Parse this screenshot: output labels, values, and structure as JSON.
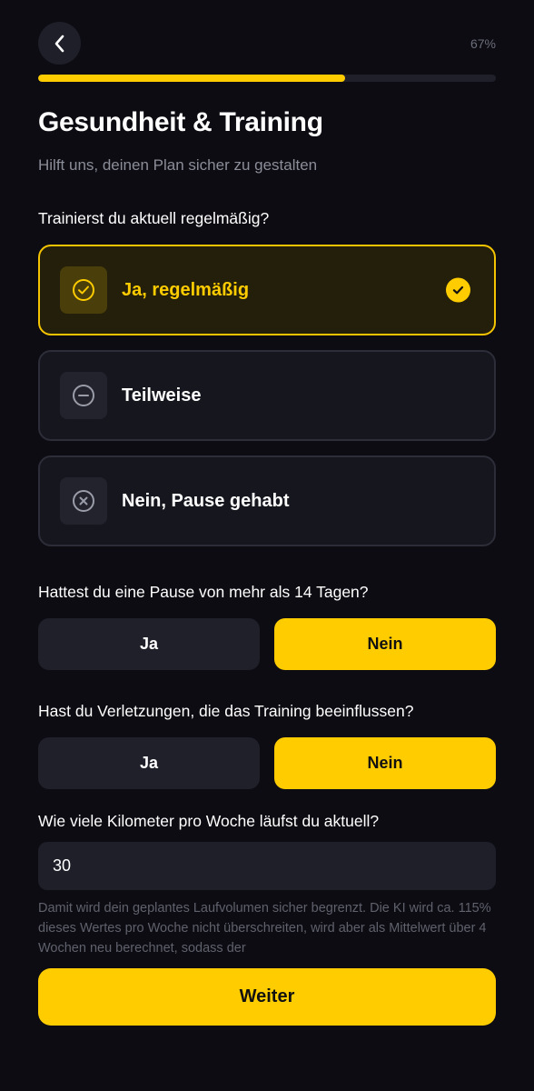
{
  "header": {
    "back_icon": "chevron-left-icon",
    "progress_text": "67%",
    "progress_value": 0.67
  },
  "title": "Gesundheit & Training",
  "subtitle": "Hilft uns, deinen Plan sicher zu gestalten",
  "training_question": {
    "label": "Trainierst du aktuell regelmäßig?",
    "options": [
      {
        "label": "Ja, regelmäßig",
        "icon": "check-circle-icon",
        "selected": true
      },
      {
        "label": "Teilweise",
        "icon": "minus-circle-icon",
        "selected": false
      },
      {
        "label": "Nein, Pause gehabt",
        "icon": "x-circle-icon",
        "selected": false
      }
    ]
  },
  "pause_question": {
    "label": "Hattest du eine Pause von mehr als 14 Tagen?",
    "yes_label": "Ja",
    "no_label": "Nein",
    "selected": "Nein"
  },
  "injury_question": {
    "label": "Hast du Verletzungen, die das Training beeinflussen?",
    "yes_label": "Ja",
    "no_label": "Nein",
    "selected": "Nein"
  },
  "km_question": {
    "label": "Wie viele Kilometer pro Woche läufst du aktuell?",
    "value": "30",
    "helper": "Damit wird dein geplantes Laufvolumen sicher begrenzt. Die KI wird ca. 115% dieses Wertes pro Woche nicht überschreiten, wird aber als Mittelwert über 4 Wochen neu berechnet, sodass der"
  },
  "continue_label": "Weiter",
  "colors": {
    "accent": "#ffcc00",
    "background": "#0c0c12",
    "surface": "#15161e"
  }
}
